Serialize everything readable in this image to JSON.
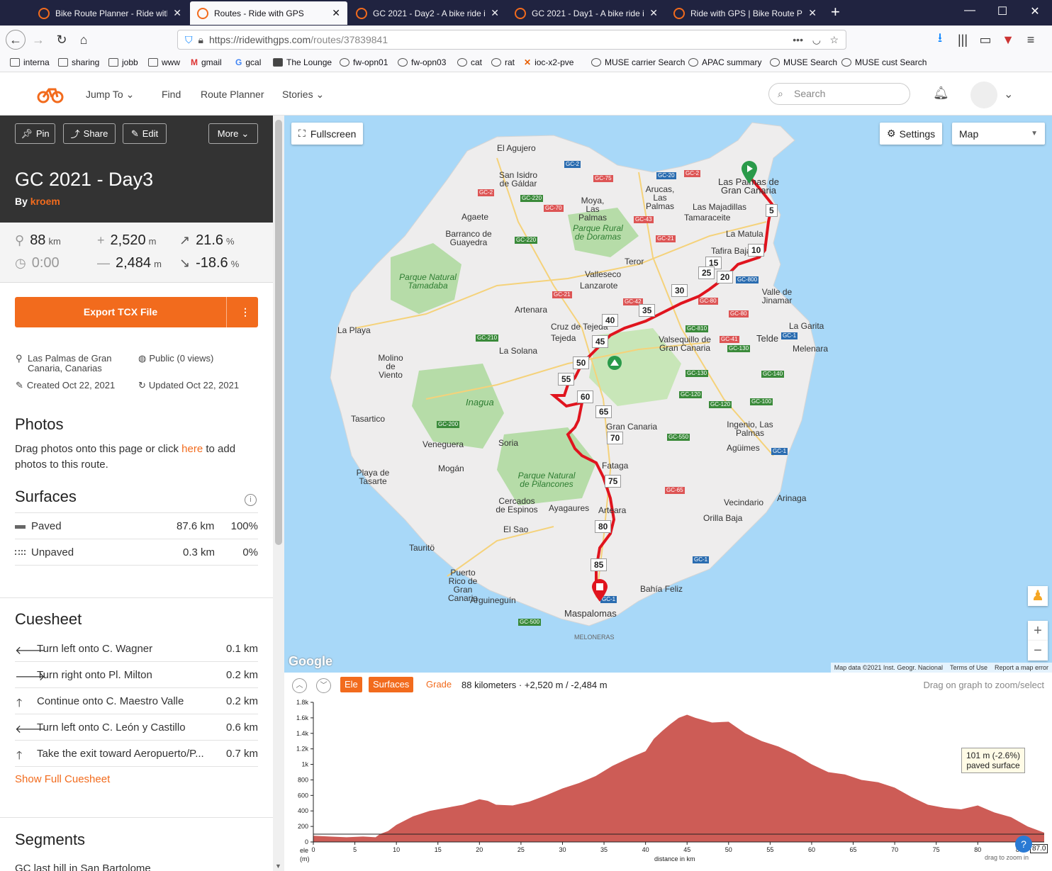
{
  "browser": {
    "tabs": [
      {
        "label": "Bike Route Planner - Ride with"
      },
      {
        "label": "Routes - Ride with GPS"
      },
      {
        "label": "GC 2021 - Day2 - A bike ride in"
      },
      {
        "label": "GC 2021 - Day1 - A bike ride in"
      },
      {
        "label": "Ride with GPS | Bike Route Plan"
      }
    ],
    "url_host": "https://ridewithgps.com",
    "url_path": "/routes/37839841",
    "bookmarks": [
      "interna",
      "sharing",
      "jobb",
      "www",
      "gmail",
      "gcal",
      "The Lounge",
      "fw-opn01",
      "fw-opn03",
      "cat",
      "rat",
      "ioc-x2-pve",
      "MUSE carrier Search",
      "APAC summary",
      "MUSE Search",
      "MUSE cust Search"
    ]
  },
  "site": {
    "nav": {
      "jump_to": "Jump To",
      "find": "Find",
      "route_planner": "Route Planner",
      "stories": "Stories"
    },
    "search_placeholder": "Search"
  },
  "route": {
    "buttons": {
      "pin": "Pin",
      "share": "Share",
      "edit": "Edit",
      "more": "More"
    },
    "title": "GC 2021 - Day3",
    "by_label": "By",
    "author": "kroem",
    "stats": {
      "distance": "88",
      "distance_unit": "km",
      "time": "0:00",
      "ascent": "2,520",
      "ascent_unit": "m",
      "descent": "2,484",
      "descent_unit": "m",
      "max_grade": "21.6",
      "max_grade_unit": "%",
      "min_grade": "-18.6",
      "min_grade_unit": "%"
    },
    "export_label": "Export TCX File",
    "location": "Las Palmas de Gran Canaria, Canarias",
    "visibility": "Public (0 views)",
    "created": "Created Oct 22, 2021",
    "updated": "Updated Oct 22, 2021",
    "photos_heading": "Photos",
    "photos_text_1": "Drag photos onto this page or click ",
    "photos_link": "here",
    "photos_text_2": " to add photos to this route.",
    "surfaces_heading": "Surfaces",
    "surfaces": [
      {
        "name": "Paved",
        "distance": "87.6 km",
        "pct": "100%"
      },
      {
        "name": "Unpaved",
        "distance": "0.3 km",
        "pct": "0%"
      }
    ],
    "cuesheet_heading": "Cuesheet",
    "cues": [
      {
        "text": "Turn left onto C. Wagner",
        "dist": "0.1 km",
        "icon": "left-arrow"
      },
      {
        "text": "Turn right onto Pl. Milton",
        "dist": "0.2 km",
        "icon": "right-arrow"
      },
      {
        "text": "Continue onto C. Maestro Valle",
        "dist": "0.2 km",
        "icon": "up-arrow"
      },
      {
        "text": "Turn left onto C. León y Castillo",
        "dist": "0.6 km",
        "icon": "left-arrow"
      },
      {
        "text": "Take the exit toward Aeropuerto/P...",
        "dist": "0.7 km",
        "icon": "up-arrow"
      }
    ],
    "show_full_cuesheet": "Show Full Cuesheet",
    "segments_heading": "Segments",
    "segment_first": "GC last hill in San Bartolome"
  },
  "map": {
    "fullscreen": "Fullscreen",
    "settings": "Settings",
    "map_type": "Map",
    "attribution": [
      "Map data ©2021 Inst. Geogr. Nacional",
      "Terms of Use",
      "Report a map error"
    ],
    "google": "Google",
    "places": [
      "El Agujero",
      "San Isidro de Gáldar",
      "Las Palmas de Gran Canaria",
      "Arucas, Las Palmas",
      "Moya, Las Palmas",
      "Las Majadillas",
      "Tamaraceite",
      "Agaete",
      "Barranco de Guayedra",
      "Parque Rural de Doramas",
      "La Matula",
      "Tafira Baja",
      "Parque Natural Tamadaba",
      "Teror",
      "Valleseco",
      "Lanzarote",
      "Valle de Jinamar",
      "Artenara",
      "Cruz de Tejeda",
      "Tejeda",
      "La Playa",
      "La Solana",
      "Valsequillo de Gran Canaria",
      "La Garita",
      "Telde",
      "Melenara",
      "Molino de Viento",
      "Inagua",
      "Tasartico",
      "Veneguera",
      "Soria",
      "Gran Canaria",
      "Ingenio, Las Palmas",
      "Agüimes",
      "Mogán",
      "Playa de Tasarte",
      "Parque Natural de Pilancones",
      "Fataga",
      "Cercados de Espinos",
      "Ayagaures",
      "Arteara",
      "Vecindario",
      "Arinaga",
      "Orilla Baja",
      "El Sao",
      "Tauritö",
      "Puerto Rico de Gran Canaria",
      "Bahía Feliz",
      "Arguineguín",
      "Maspalomas",
      "MELONERAS"
    ],
    "km_markers": [
      "5",
      "10",
      "15",
      "20",
      "25",
      "30",
      "35",
      "40",
      "45",
      "50",
      "55",
      "60",
      "65",
      "70",
      "75",
      "80",
      "85"
    ]
  },
  "elevation": {
    "tabs": {
      "ele": "Ele",
      "surfaces": "Surfaces",
      "grade": "Grade"
    },
    "summary": "88 kilometers · +2,520 m / -2,484 m",
    "hint": "Drag on graph to zoom/select",
    "tooltip_line1": "101 m (-2.6%)",
    "tooltip_line2": "paved surface",
    "x_label": "distance in km",
    "y_label_1": "ele",
    "y_label_2": "(m)",
    "drag_hint": "drag to zoom in",
    "end_value": "87.0",
    "colors": {
      "fill": "#cd5c56",
      "accent": "#f26b1d",
      "route": "#e0141e"
    }
  },
  "chart_data": {
    "type": "area",
    "xlabel": "distance in km",
    "ylabel": "ele (m)",
    "xlim": [
      0,
      88
    ],
    "ylim": [
      0,
      1800
    ],
    "x_ticks": [
      0,
      5,
      10,
      15,
      20,
      25,
      30,
      35,
      40,
      45,
      50,
      55,
      60,
      65,
      70,
      75,
      80,
      85
    ],
    "y_ticks": [
      "0",
      "200",
      "400",
      "600",
      "800",
      "1k",
      "1.2k",
      "1.4k",
      "1.6k",
      "1.8k"
    ],
    "y_tick_values": [
      0,
      200,
      400,
      600,
      800,
      1000,
      1200,
      1400,
      1600,
      1800
    ],
    "x": [
      0,
      2,
      4,
      6,
      7.5,
      8,
      9,
      10,
      12,
      14,
      16,
      18,
      20,
      21,
      22,
      24,
      26,
      28,
      30,
      32,
      34,
      36,
      38,
      40,
      41,
      42,
      43,
      44,
      45,
      46,
      48,
      50,
      52,
      54,
      56,
      58,
      60,
      62,
      64,
      66,
      68,
      70,
      72,
      74,
      76,
      78,
      80,
      82,
      84,
      86,
      88
    ],
    "y": [
      80,
      70,
      60,
      70,
      60,
      100,
      140,
      220,
      330,
      400,
      440,
      480,
      550,
      530,
      480,
      470,
      520,
      600,
      690,
      760,
      850,
      980,
      1080,
      1170,
      1330,
      1430,
      1520,
      1600,
      1640,
      1600,
      1540,
      1550,
      1400,
      1300,
      1230,
      1130,
      1000,
      900,
      870,
      800,
      770,
      700,
      580,
      480,
      440,
      420,
      470,
      380,
      320,
      200,
      120
    ]
  }
}
